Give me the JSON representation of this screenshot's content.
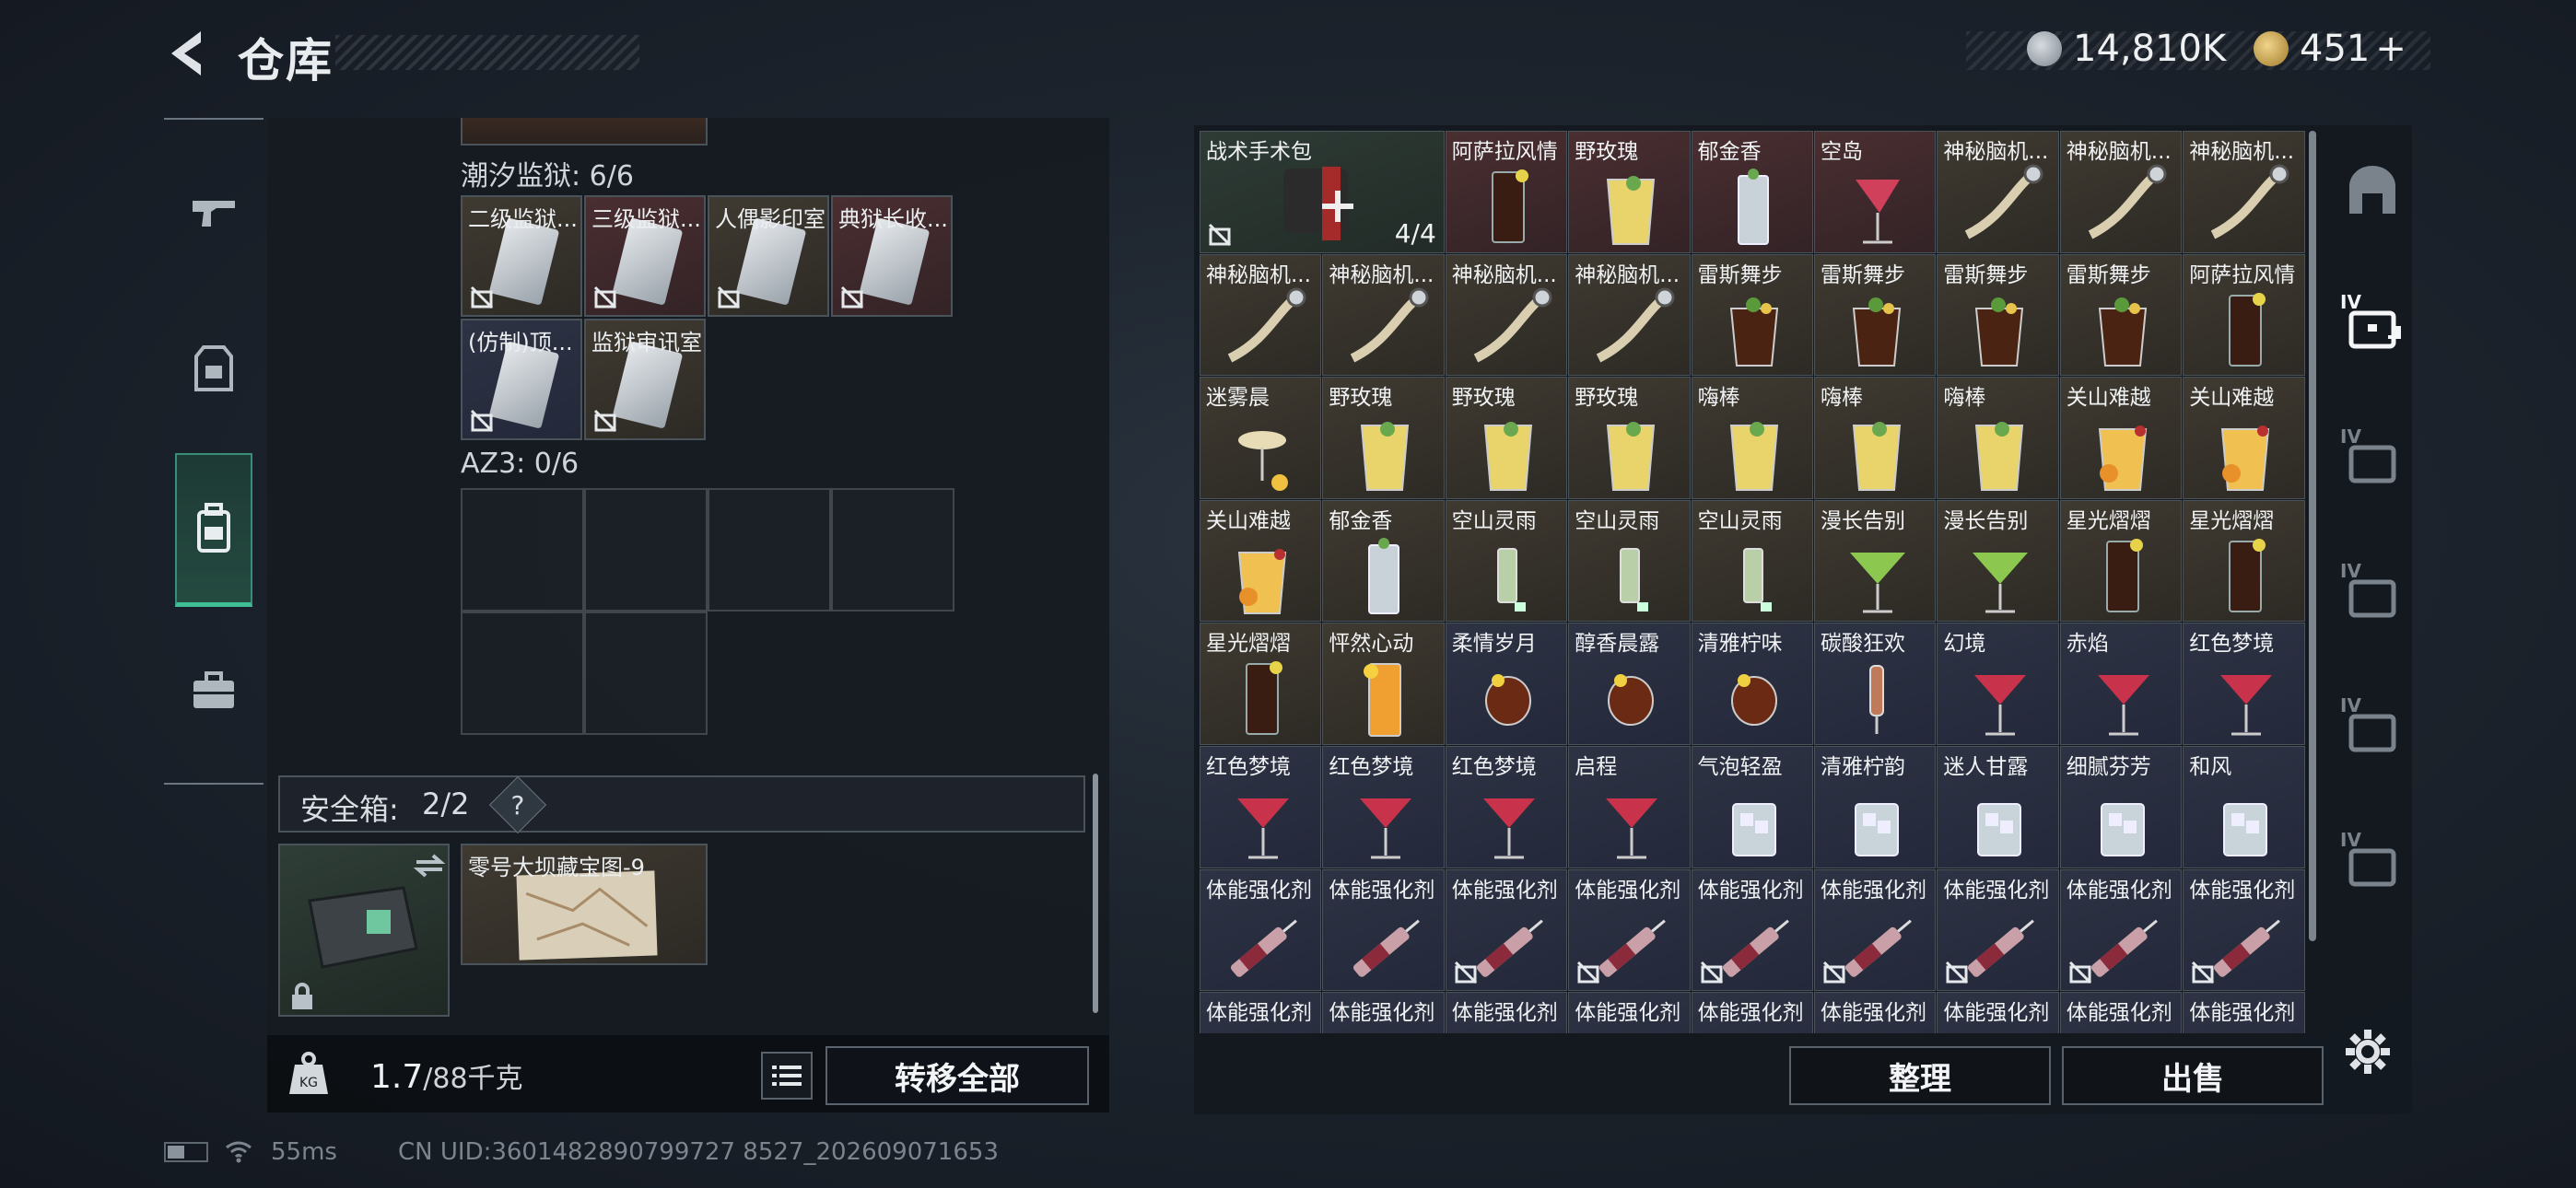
{
  "header": {
    "title": "仓库",
    "currency1": {
      "value": "14,810K",
      "icon": "silver-coin-icon",
      "color": "#9aa3ab"
    },
    "currency2": {
      "value": "451",
      "plus": "+",
      "icon": "gold-triangle-coin-icon",
      "color": "#c9a34a"
    }
  },
  "left_nav": [
    {
      "icon": "pistol-icon",
      "active": false
    },
    {
      "icon": "vest-icon",
      "active": false
    },
    {
      "icon": "backpack-icon",
      "active": true
    },
    {
      "icon": "toolbox-icon",
      "active": false
    }
  ],
  "sections": {
    "tide_prison": {
      "label": "潮汐监狱: 6/6",
      "items": [
        {
          "name": "二级监狱...",
          "color": "brown"
        },
        {
          "name": "三级监狱...",
          "color": "red"
        },
        {
          "name": "人偶影印室",
          "color": "brown"
        },
        {
          "name": "典狱长收...",
          "color": "red"
        },
        {
          "name": "(仿制)顶...",
          "color": "blue"
        },
        {
          "name": "监狱审讯室",
          "color": "brown"
        }
      ]
    },
    "az3": {
      "label": "AZ3: 0/6"
    },
    "safe_box": {
      "label": "安全箱:",
      "count": "2/2",
      "help": "?",
      "map_item": "零号大坝藏宝图-9"
    }
  },
  "weight": {
    "current": "1.7",
    "max": "/88千克"
  },
  "buttons": {
    "transfer_all": "转移全部",
    "organize": "整理",
    "sell": "出售"
  },
  "stash_rows": [
    [
      {
        "name": "战术手术包",
        "color": "green",
        "count": "4/4",
        "kind": "medkit"
      },
      {
        "name": "阿萨拉风情",
        "color": "red",
        "kind": "tall-dark"
      },
      {
        "name": "野玫瑰",
        "color": "red",
        "kind": "yellow"
      },
      {
        "name": "郁金香",
        "color": "red",
        "kind": "clear"
      },
      {
        "name": "空岛",
        "color": "red",
        "kind": "pink-stem"
      },
      {
        "name": "神秘脑机...",
        "color": "brown",
        "kind": "cable"
      },
      {
        "name": "神秘脑机...",
        "color": "brown",
        "kind": "cable"
      },
      {
        "name": "神秘脑机...",
        "color": "brown",
        "kind": "cable"
      }
    ],
    [
      {
        "name": "神秘脑机...",
        "color": "brown",
        "kind": "cable"
      },
      {
        "name": "神秘脑机...",
        "color": "brown",
        "kind": "cable"
      },
      {
        "name": "神秘脑机...",
        "color": "brown",
        "kind": "cable"
      },
      {
        "name": "神秘脑机...",
        "color": "brown",
        "kind": "cable"
      },
      {
        "name": "雷斯舞步",
        "color": "brown",
        "kind": "dark-mint"
      },
      {
        "name": "雷斯舞步",
        "color": "brown",
        "kind": "dark-mint"
      },
      {
        "name": "雷斯舞步",
        "color": "brown",
        "kind": "dark-mint"
      },
      {
        "name": "雷斯舞步",
        "color": "brown",
        "kind": "dark-mint"
      },
      {
        "name": "阿萨拉风情",
        "color": "brown",
        "kind": "tall-dark"
      }
    ],
    [
      {
        "name": "迷雾晨",
        "color": "brown",
        "kind": "coupe"
      },
      {
        "name": "野玫瑰",
        "color": "brown",
        "kind": "yellow"
      },
      {
        "name": "野玫瑰",
        "color": "brown",
        "kind": "yellow"
      },
      {
        "name": "野玫瑰",
        "color": "brown",
        "kind": "yellow"
      },
      {
        "name": "嗨棒",
        "color": "brown",
        "kind": "yellow"
      },
      {
        "name": "嗨棒",
        "color": "brown",
        "kind": "yellow"
      },
      {
        "name": "嗨棒",
        "color": "brown",
        "kind": "yellow"
      },
      {
        "name": "关山难越",
        "color": "brown",
        "kind": "orange"
      },
      {
        "name": "关山难越",
        "color": "brown",
        "kind": "orange"
      }
    ],
    [
      {
        "name": "关山难越",
        "color": "brown",
        "kind": "orange"
      },
      {
        "name": "郁金香",
        "color": "brown",
        "kind": "clear"
      },
      {
        "name": "空山灵雨",
        "color": "brown",
        "kind": "green-stem"
      },
      {
        "name": "空山灵雨",
        "color": "brown",
        "kind": "green-stem"
      },
      {
        "name": "空山灵雨",
        "color": "brown",
        "kind": "green-stem"
      },
      {
        "name": "漫长告别",
        "color": "brown",
        "kind": "green-martini"
      },
      {
        "name": "漫长告别",
        "color": "brown",
        "kind": "green-martini"
      },
      {
        "name": "星光熠熠",
        "color": "brown",
        "kind": "tall-dark"
      },
      {
        "name": "星光熠熠",
        "color": "brown",
        "kind": "tall-dark"
      }
    ],
    [
      {
        "name": "星光熠熠",
        "color": "brown",
        "kind": "tall-dark"
      },
      {
        "name": "怦然心动",
        "color": "brown",
        "kind": "orange-tall"
      },
      {
        "name": "柔情岁月",
        "color": "blue",
        "kind": "brandy"
      },
      {
        "name": "醇香晨露",
        "color": "blue",
        "kind": "brandy"
      },
      {
        "name": "清雅柠味",
        "color": "blue",
        "kind": "brandy"
      },
      {
        "name": "碳酸狂欢",
        "color": "blue",
        "kind": "flute"
      },
      {
        "name": "幻境",
        "color": "blue",
        "kind": "red-martini"
      },
      {
        "name": "赤焰",
        "color": "blue",
        "kind": "red-martini"
      },
      {
        "name": "红色梦境",
        "color": "blue",
        "kind": "red-martini"
      }
    ],
    [
      {
        "name": "红色梦境",
        "color": "blue",
        "kind": "red-martini"
      },
      {
        "name": "红色梦境",
        "color": "blue",
        "kind": "red-martini"
      },
      {
        "name": "红色梦境",
        "color": "blue",
        "kind": "red-martini"
      },
      {
        "name": "启程",
        "color": "blue",
        "kind": "red-martini"
      },
      {
        "name": "气泡轻盈",
        "color": "blue",
        "kind": "ice"
      },
      {
        "name": "清雅柠韵",
        "color": "blue",
        "kind": "ice"
      },
      {
        "name": "迷人甘露",
        "color": "blue",
        "kind": "ice"
      },
      {
        "name": "细腻芬芳",
        "color": "blue",
        "kind": "ice"
      },
      {
        "name": "和风",
        "color": "blue",
        "kind": "ice"
      }
    ],
    [
      {
        "name": "体能强化剂",
        "color": "blue",
        "kind": "syringe"
      },
      {
        "name": "体能强化剂",
        "color": "blue",
        "kind": "syringe"
      },
      {
        "name": "体能强化剂",
        "color": "blue",
        "kind": "syringe"
      },
      {
        "name": "体能强化剂",
        "color": "blue",
        "kind": "syringe"
      },
      {
        "name": "体能强化剂",
        "color": "blue",
        "kind": "syringe"
      },
      {
        "name": "体能强化剂",
        "color": "blue",
        "kind": "syringe"
      },
      {
        "name": "体能强化剂",
        "color": "blue",
        "kind": "syringe"
      },
      {
        "name": "体能强化剂",
        "color": "blue",
        "kind": "syringe"
      },
      {
        "name": "体能强化剂",
        "color": "blue",
        "kind": "syringe"
      }
    ],
    [
      {
        "name": "体能强化剂",
        "color": "blue",
        "kind": "syringe"
      },
      {
        "name": "体能强化剂",
        "color": "blue",
        "kind": "syringe"
      },
      {
        "name": "体能强化剂",
        "color": "blue",
        "kind": "syringe"
      },
      {
        "name": "体能强化剂",
        "color": "blue",
        "kind": "syringe"
      },
      {
        "name": "体能强化剂",
        "color": "blue",
        "kind": "syringe"
      },
      {
        "name": "体能强化剂",
        "color": "blue",
        "kind": "syringe"
      },
      {
        "name": "体能强化剂",
        "color": "blue",
        "kind": "syringe"
      },
      {
        "name": "体能强化剂",
        "color": "blue",
        "kind": "syringe"
      },
      {
        "name": "体能强化剂",
        "color": "blue",
        "kind": "syringe"
      }
    ]
  ],
  "right_nav": [
    {
      "icon": "stash-dome-icon",
      "active": false
    },
    {
      "icon": "medkit-tier-icon",
      "label": "IV",
      "active": true
    },
    {
      "icon": "folder-tier-icon",
      "label": "IV",
      "active": false
    },
    {
      "icon": "gun-case-tier-icon",
      "label": "IV",
      "active": false
    },
    {
      "icon": "map-tier-icon",
      "label": "IV",
      "active": false
    },
    {
      "icon": "box-tier-icon",
      "label": "IV",
      "active": false
    }
  ],
  "status": {
    "ping": "55ms",
    "uid": "CN UID:3601482890799727 8527_202609071653"
  }
}
